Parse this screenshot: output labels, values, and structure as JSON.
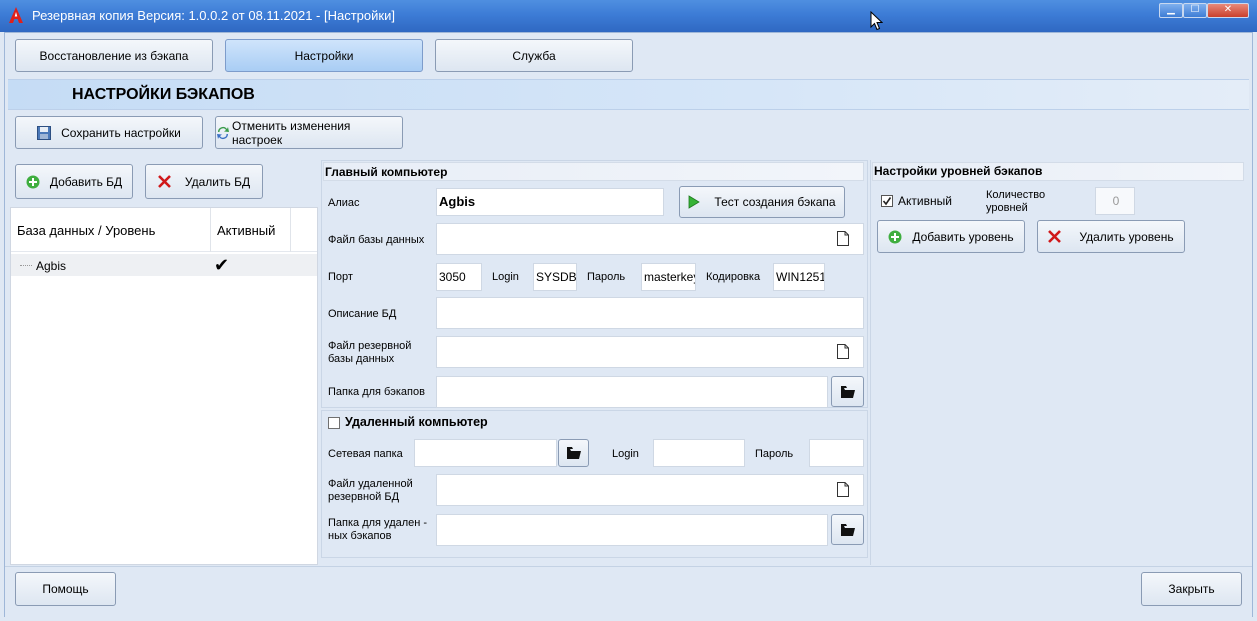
{
  "window": {
    "title": "Резервная копия   Версия: 1.0.0.2 от 08.11.2021 - [Настройки]",
    "min_glyph": "▁",
    "max_glyph": "☐",
    "close_glyph": "✕"
  },
  "tabs": [
    {
      "label": "Восстановление из бэкапа",
      "active": false
    },
    {
      "label": "Настройки",
      "active": true
    },
    {
      "label": "Служба",
      "active": false
    }
  ],
  "header": {
    "title": "НАСТРОЙКИ БЭКАПОВ"
  },
  "toolbar": {
    "save_label": "Сохранить настройки",
    "cancel_label": "Отменить изменения настроек"
  },
  "left": {
    "add_db_label": "Добавить БД",
    "delete_db_label": "Удалить БД",
    "columns": [
      "База данных / Уровень",
      "Активный"
    ],
    "rows": [
      {
        "name": "Agbis",
        "active_mark": "✔"
      }
    ]
  },
  "main_computer": {
    "title": "Главный компьютер",
    "alias_label": "Алиас",
    "alias_value": "Agbis",
    "test_button": "Тест создания бэкапа",
    "db_file_label": "Файл базы данных",
    "db_file_value": "",
    "port_label": "Порт",
    "port_value": "3050",
    "login_label": "Login",
    "login_value": "SYSDBA",
    "password_label": "Пароль",
    "password_value": "masterkey",
    "encoding_label": "Кодировка",
    "encoding_value": "WIN1251",
    "description_label": "Описание БД",
    "description_value": "",
    "backup_file_label_1": "Файл резервной",
    "backup_file_label_2": "базы данных",
    "backup_file_value": "",
    "backup_folder_label": "Папка для бэкапов",
    "backup_folder_value": ""
  },
  "remote_computer": {
    "title": "Удаленный компьютер",
    "network_folder_label": "Сетевая папка",
    "network_folder_value": "",
    "login_label": "Login",
    "login_value": "",
    "password_label": "Пароль",
    "password_value": "",
    "remote_file_label_1": "Файл удаленной",
    "remote_file_label_2": "резервной БД",
    "remote_file_value": "",
    "remote_folder_label_1": "Папка для удален -",
    "remote_folder_label_2": "ных бэкапов",
    "remote_folder_value": ""
  },
  "levels": {
    "title": "Настройки уровней бэкапов",
    "active_label": "Активный",
    "count_label_1": "Количество",
    "count_label_2": "уровней",
    "count_value": "0",
    "add_level_label": "Добавить уровень",
    "delete_level_label": "Удалить уровень"
  },
  "footer": {
    "help_label": "Помощь",
    "close_label": "Закрыть"
  },
  "colors": {
    "titlebar": "#3d7cd6",
    "background": "#dfe8f4",
    "active_tab": "#bcd9f8",
    "delete_red": "#d0181a",
    "add_green": "#3fae3f"
  }
}
